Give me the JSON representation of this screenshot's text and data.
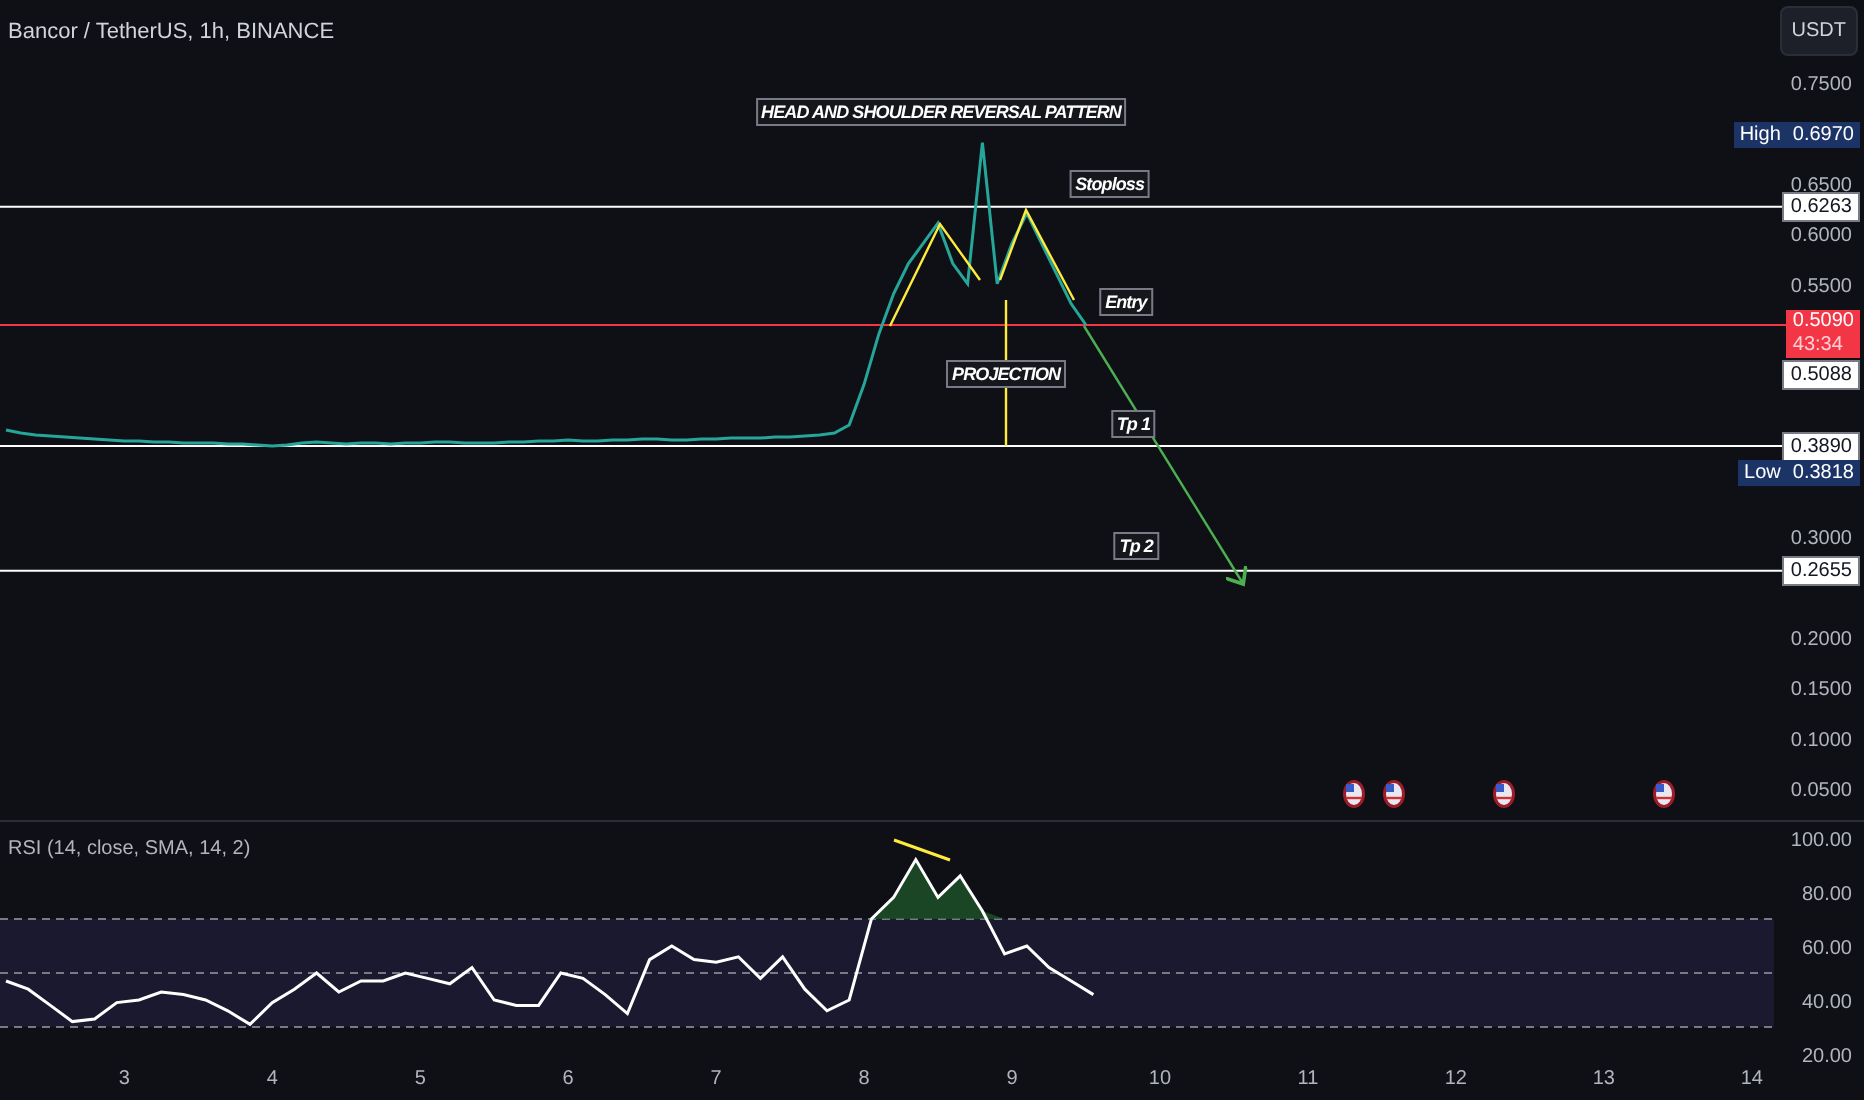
{
  "header": {
    "title": "Bancor / TetherUS, 1h, BINANCE"
  },
  "currency_button": {
    "label": "USDT"
  },
  "price_chart": {
    "chart_data": {
      "type": "line",
      "series": [
        {
          "color": "#26a69a",
          "values": [
            0.405,
            0.402,
            0.4,
            0.399,
            0.398,
            0.397,
            0.396,
            0.395,
            0.394,
            0.394,
            0.393,
            0.393,
            0.392,
            0.392,
            0.392,
            0.391,
            0.391,
            0.39,
            0.389,
            0.39,
            0.392,
            0.393,
            0.392,
            0.391,
            0.392,
            0.392,
            0.391,
            0.392,
            0.392,
            0.393,
            0.393,
            0.392,
            0.392,
            0.392,
            0.393,
            0.393,
            0.394,
            0.394,
            0.395,
            0.394,
            0.394,
            0.395,
            0.395,
            0.396,
            0.396,
            0.395,
            0.395,
            0.396,
            0.396,
            0.397,
            0.397,
            0.397,
            0.398,
            0.398,
            0.399,
            0.4,
            0.402,
            0.41,
            0.45,
            0.5,
            0.54,
            0.57,
            0.59,
            0.61,
            0.57,
            0.55,
            0.69,
            0.55,
            0.59,
            0.62,
            0.59,
            0.56,
            0.53,
            0.509
          ]
        }
      ],
      "yticks": [
        {
          "value": 0.75,
          "label": "0.7500"
        },
        {
          "value": 0.65,
          "label": "0.6500"
        },
        {
          "value": 0.6,
          "label": "0.6000"
        },
        {
          "value": 0.55,
          "label": "0.5500"
        },
        {
          "value": 0.3,
          "label": "0.3000"
        },
        {
          "value": 0.2,
          "label": "0.2000"
        },
        {
          "value": 0.15,
          "label": "0.1500"
        },
        {
          "value": 0.1,
          "label": "0.1000"
        },
        {
          "value": 0.05,
          "label": "0.0500"
        }
      ],
      "ylim": [
        0.05,
        0.75
      ],
      "ref_lines": [
        {
          "axis": "y",
          "value": 0.6263,
          "color": "#ffffff",
          "label": "0.6263"
        },
        {
          "axis": "y",
          "value": 0.509,
          "color": "#f23645",
          "label": "0.5090"
        },
        {
          "axis": "y",
          "value": 0.389,
          "color": "#ffffff",
          "label": "0.3890"
        },
        {
          "axis": "y",
          "value": 0.2655,
          "color": "#ffffff",
          "label": "0.2655"
        }
      ]
    },
    "countdown": "43:34",
    "drawing_labels": [
      "HEAD AND SHOULDER REVERSAL PATTERN",
      "Stoploss",
      "Entry",
      "PROJECTION",
      "Tp 1",
      "Tp 2"
    ],
    "price_tags": [
      {
        "kind": "extreme",
        "label": "High",
        "text": "0.6970"
      },
      {
        "kind": "level",
        "text": "0.5088"
      },
      {
        "kind": "extreme",
        "label": "Low",
        "text": "0.3818"
      }
    ]
  },
  "rsi": {
    "legend": "RSI (14, close, SMA, 14, 2)",
    "chart_data": {
      "type": "line",
      "x": [
        2.2,
        2.35,
        2.5,
        2.65,
        2.8,
        2.95,
        3.1,
        3.25,
        3.4,
        3.55,
        3.7,
        3.85,
        4,
        4.15,
        4.3,
        4.45,
        4.6,
        4.75,
        4.9,
        5.05,
        5.2,
        5.35,
        5.5,
        5.65,
        5.8,
        5.95,
        6.1,
        6.25,
        6.4,
        6.55,
        6.7,
        6.85,
        7,
        7.15,
        7.3,
        7.45,
        7.6,
        7.75,
        7.9,
        8.05,
        8.2,
        8.35,
        8.5,
        8.65,
        8.8,
        8.95,
        9.1,
        9.25,
        9.4,
        9.55
      ],
      "series": [
        {
          "color": "#ffffff",
          "values": [
            47,
            44,
            38,
            32,
            33,
            39,
            40,
            43,
            42,
            40,
            36,
            31,
            39,
            44,
            50,
            43,
            47,
            47,
            50,
            48,
            46,
            52,
            40,
            38,
            38,
            50,
            48,
            42,
            35,
            55,
            60,
            55,
            54,
            56,
            48,
            56,
            44,
            36,
            40,
            70,
            78,
            92,
            78,
            86,
            73,
            57,
            60,
            52,
            47,
            42
          ]
        }
      ],
      "xlim": [
        2.16,
        14.15
      ],
      "ylim": [
        20,
        100
      ],
      "bands": [
        {
          "axis": "y",
          "from": 30,
          "to": 70
        }
      ],
      "yticks": [
        {
          "value": 100,
          "label": "100.00"
        },
        {
          "value": 80,
          "label": "80.00"
        },
        {
          "value": 60,
          "label": "60.00"
        },
        {
          "value": 40,
          "label": "40.00"
        },
        {
          "value": 20,
          "label": "20.00"
        }
      ],
      "xticks": [
        3,
        4,
        5,
        6,
        7,
        8,
        9,
        10,
        11,
        12,
        13,
        14
      ]
    }
  }
}
